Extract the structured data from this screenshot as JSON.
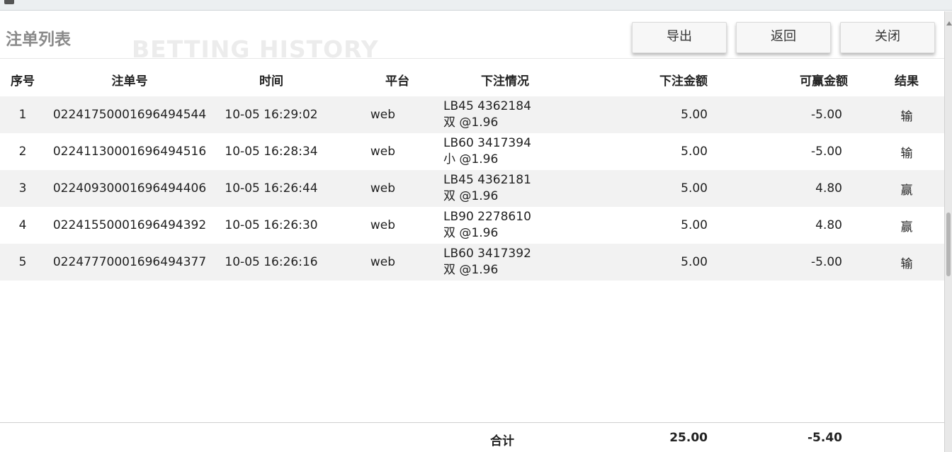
{
  "dialog": {
    "title": "注单列表",
    "watermark": "BETTING HISTORY",
    "buttons": {
      "export": "导出",
      "back": "返回",
      "close": "关闭"
    }
  },
  "table": {
    "columns": [
      "序号",
      "注单号",
      "时间",
      "平台",
      "下注情况",
      "下注金额",
      "可赢金额",
      "结果"
    ],
    "rows": [
      {
        "idx": "1",
        "order_no": "02241750001696494544",
        "time": "10-05 16:29:02",
        "platform": "web",
        "detail_line1": "LB45 4362184",
        "detail_line2": "双 @1.96",
        "bet": "5.00",
        "win": "-5.00",
        "result": "输"
      },
      {
        "idx": "2",
        "order_no": "02241130001696494516",
        "time": "10-05 16:28:34",
        "platform": "web",
        "detail_line1": "LB60 3417394",
        "detail_line2": "小 @1.96",
        "bet": "5.00",
        "win": "-5.00",
        "result": "输"
      },
      {
        "idx": "3",
        "order_no": "02240930001696494406",
        "time": "10-05 16:26:44",
        "platform": "web",
        "detail_line1": "LB45 4362181",
        "detail_line2": "双 @1.96",
        "bet": "5.00",
        "win": "4.80",
        "result": "赢"
      },
      {
        "idx": "4",
        "order_no": "02241550001696494392",
        "time": "10-05 16:26:30",
        "platform": "web",
        "detail_line1": "LB90 2278610",
        "detail_line2": "双 @1.96",
        "bet": "5.00",
        "win": "4.80",
        "result": "赢"
      },
      {
        "idx": "5",
        "order_no": "02247770001696494377",
        "time": "10-05 16:26:16",
        "platform": "web",
        "detail_line1": "LB60 3417392",
        "detail_line2": "双 @1.96",
        "bet": "5.00",
        "win": "-5.00",
        "result": "输"
      }
    ]
  },
  "footer": {
    "total_label": "合计",
    "total_bet": "25.00",
    "total_win": "-5.40"
  }
}
